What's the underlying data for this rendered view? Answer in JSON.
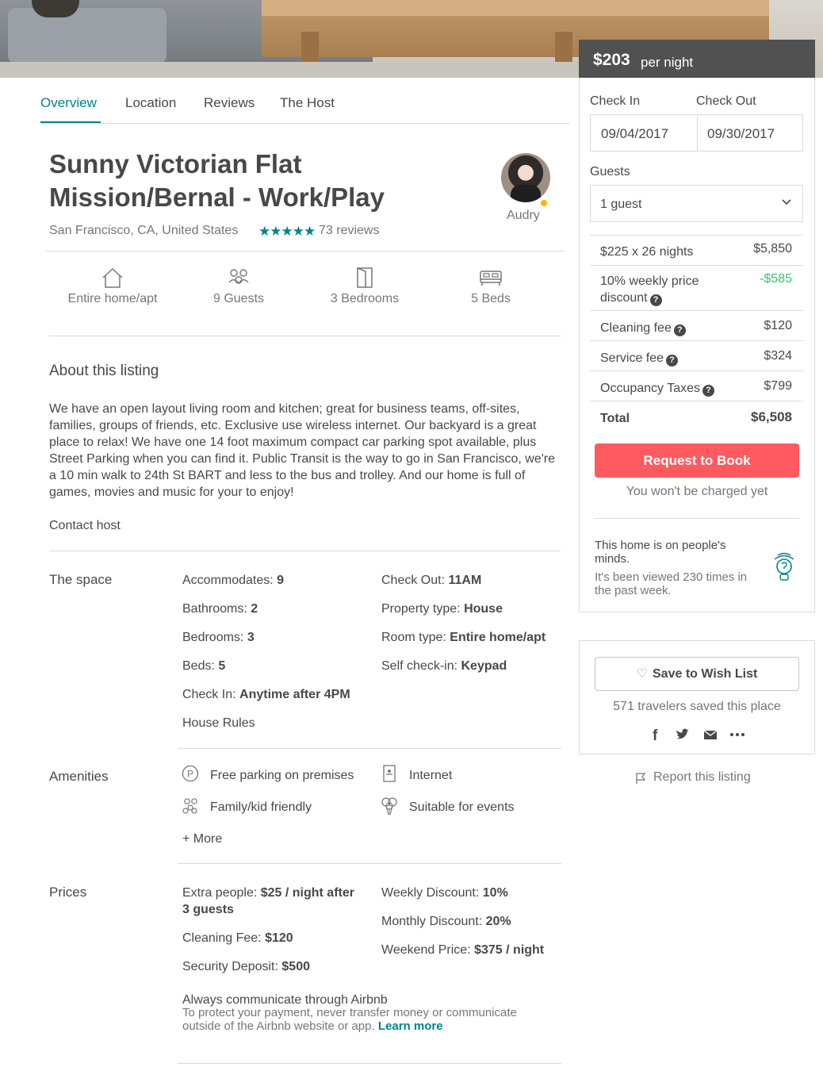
{
  "tabs": [
    {
      "label": "Overview"
    },
    {
      "label": "Location"
    },
    {
      "label": "Reviews"
    },
    {
      "label": "The Host"
    }
  ],
  "listing": {
    "title_line1": "Sunny Victorian Flat",
    "title_line2": "Mission/Bernal - Work/Play",
    "location": "San Francisco, CA, United States",
    "stars": "★★★★★",
    "reviews": "73 reviews",
    "host_name": "Audry"
  },
  "summary": [
    {
      "icon": "home-icon",
      "label": "Entire home/apt"
    },
    {
      "icon": "guests-icon",
      "label": "9 Guests"
    },
    {
      "icon": "door-icon",
      "label": "3 Bedrooms"
    },
    {
      "icon": "bed-icon",
      "label": "5 Beds"
    }
  ],
  "about": {
    "heading": "About this listing",
    "text": "We have an open layout living room and kitchen; great for business teams, off-sites, families, groups of friends, etc. Exclusive use wireless internet. Our backyard is a great place to relax! We have one 14 foot maximum compact car parking spot available, plus Street Parking when you can find it. Public Transit is the way to go in San Francisco, we're a 10 min walk to 24th St BART and less to the bus and trolley. And our home is full of games, movies and music for your to enjoy!",
    "contact": "Contact host"
  },
  "space": {
    "label": "The space",
    "left": [
      {
        "k": "Accommodates:",
        "v": "9"
      },
      {
        "k": "Bathrooms:",
        "v": "2"
      },
      {
        "k": "Bedrooms:",
        "v": "3"
      },
      {
        "k": "Beds:",
        "v": "5"
      },
      {
        "k": "Check In:",
        "v": "Anytime after 4PM"
      }
    ],
    "right": [
      {
        "k": "Check Out:",
        "v": "11AM"
      },
      {
        "k": "Property type:",
        "v": "House"
      },
      {
        "k": "Room type:",
        "v": "Entire home/apt"
      },
      {
        "k": "Self check-in:",
        "v": "Keypad"
      }
    ],
    "house_rules": "House Rules"
  },
  "amenities": {
    "label": "Amenities",
    "items": [
      {
        "icon": "parking-icon",
        "label": "Free parking on premises"
      },
      {
        "icon": "internet-icon",
        "label": "Internet"
      },
      {
        "icon": "family-icon",
        "label": "Family/kid friendly"
      },
      {
        "icon": "balloons-icon",
        "label": "Suitable for events"
      }
    ],
    "more": "+ More"
  },
  "prices": {
    "label": "Prices",
    "extra_k": "Extra people:",
    "extra_v": "$25 / night after 3 guests",
    "cleaning_k": "Cleaning Fee:",
    "cleaning_v": "$120",
    "deposit_k": "Security Deposit:",
    "deposit_v": "$500",
    "weekly_k": "Weekly Discount:",
    "weekly_v": "10%",
    "monthly_k": "Monthly Discount:",
    "monthly_v": "20%",
    "weekend_k": "Weekend Price:",
    "weekend_v": "$375 / night",
    "notice_h": "Always communicate through Airbnb",
    "notice_p": "To protect your payment, never transfer money or communicate outside of the Airbnb website or app.",
    "learn_more": "Learn more"
  },
  "booking": {
    "price": "$203",
    "per_night": "per night",
    "check_in_label": "Check In",
    "check_out_label": "Check Out",
    "check_in": "09/04/2017",
    "check_out": "09/30/2017",
    "guests_label": "Guests",
    "guests_value": "1 guest",
    "fees": [
      {
        "label": "$225 x 26 nights",
        "value": "$5,850",
        "help": false
      },
      {
        "label": "10% weekly price discount",
        "value": "-$585",
        "help": true
      },
      {
        "label": "Cleaning fee",
        "value": "$120",
        "help": true
      },
      {
        "label": "Service fee",
        "value": "$324",
        "help": true
      },
      {
        "label": "Occupancy Taxes",
        "value": "$799",
        "help": true
      }
    ],
    "total_label": "Total",
    "total_value": "$6,508",
    "request_button": "Request to Book",
    "no_charge": "You won't be charged yet",
    "minds_heading": "This home is on people's minds.",
    "minds_text": "It's been viewed 230 times in the past week.",
    "discount_color": "#3ebf6e",
    "accent": "#ff5a5f",
    "teal": "#008489"
  },
  "wishlist": {
    "button": "Save to Wish List",
    "saved": "571 travelers saved this place",
    "share": [
      "facebook-icon",
      "twitter-icon",
      "email-icon",
      "more-icon"
    ],
    "report": "Report this listing"
  }
}
